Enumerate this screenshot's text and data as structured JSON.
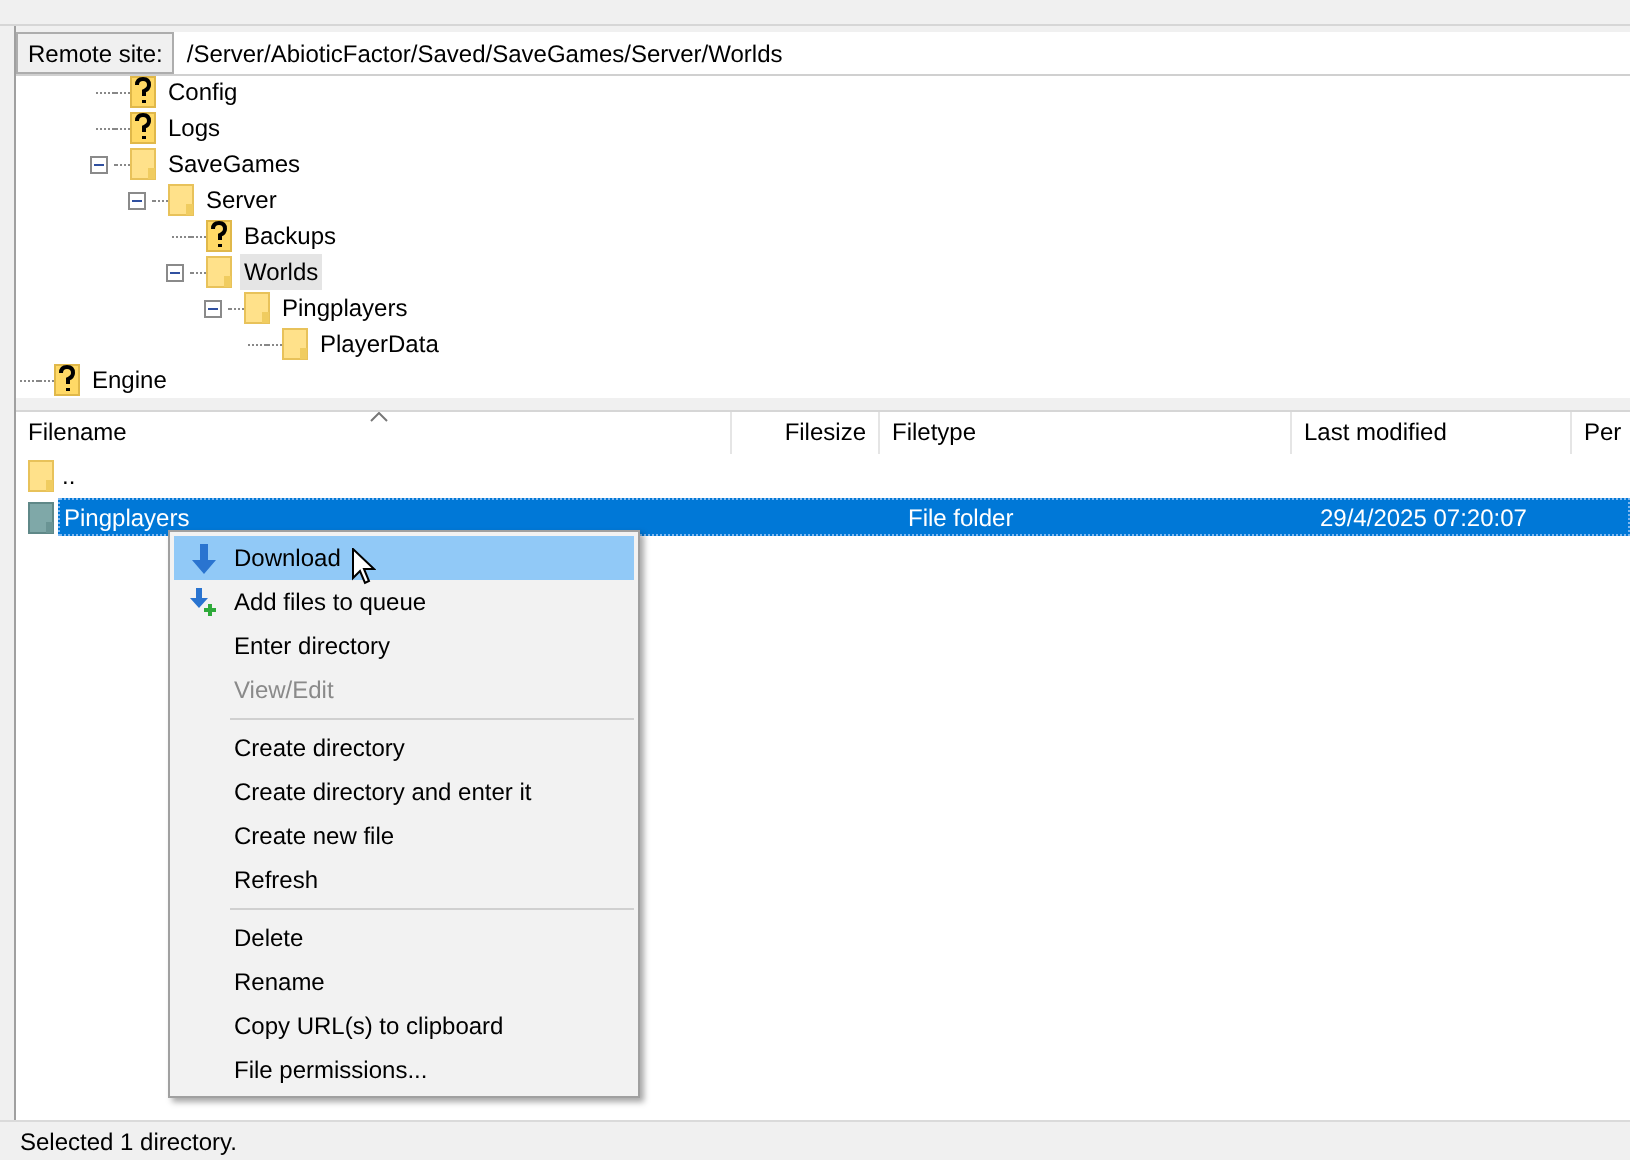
{
  "remote_site": {
    "label": "Remote site:",
    "path": "/Server/AbioticFactor/Saved/SaveGames/Server/Worlds"
  },
  "tree": {
    "items": [
      {
        "children": [
          {
            "children": [
              {
                "label": "Config",
                "kind": "unknown",
                "selected": false
              },
              {
                "label": "Logs",
                "kind": "unknown",
                "selected": false
              },
              {
                "label": "SaveGames",
                "kind": "folder",
                "selected": false,
                "expanded": true,
                "children": [
                  {
                    "label": "Server",
                    "kind": "folder",
                    "selected": false,
                    "expanded": true,
                    "children": [
                      {
                        "label": "Backups",
                        "kind": "unknown",
                        "selected": false
                      },
                      {
                        "label": "Worlds",
                        "kind": "folder",
                        "selected": true,
                        "expanded": true,
                        "children": [
                          {
                            "label": "Pingplayers",
                            "kind": "folder",
                            "selected": false,
                            "expanded": true,
                            "children": [
                              {
                                "label": "PlayerData",
                                "kind": "folder",
                                "selected": false
                              }
                            ]
                          }
                        ]
                      }
                    ]
                  }
                ]
              }
            ]
          }
        ]
      },
      {
        "label": "Engine",
        "kind": "unknown",
        "selected": false
      }
    ]
  },
  "file_list": {
    "columns": [
      "Filename",
      "Filesize",
      "Filetype",
      "Last modified",
      "Per"
    ],
    "rows": [
      {
        "filename": "..",
        "filesize": "",
        "filetype": "",
        "last_modified": "",
        "selected": false
      },
      {
        "filename": "Pingplayers",
        "filesize": "",
        "filetype": "File folder",
        "last_modified": "29/4/2025 07:20:07",
        "selected": true
      }
    ]
  },
  "context_menu": {
    "items": [
      {
        "kind": "download",
        "label": "Download",
        "selected": true,
        "disabled": false
      },
      {
        "kind": "queue",
        "label": "Add files to queue",
        "selected": false,
        "disabled": false
      },
      {
        "kind": "item",
        "label": "Enter directory",
        "selected": false,
        "disabled": false
      },
      {
        "kind": "item",
        "label": "View/Edit",
        "selected": false,
        "disabled": true
      },
      {
        "kind": "separator"
      },
      {
        "kind": "item",
        "label": "Create directory",
        "selected": false,
        "disabled": false
      },
      {
        "kind": "item",
        "label": "Create directory and enter it",
        "selected": false,
        "disabled": false
      },
      {
        "kind": "item",
        "label": "Create new file",
        "selected": false,
        "disabled": false
      },
      {
        "kind": "item",
        "label": "Refresh",
        "selected": false,
        "disabled": false
      },
      {
        "kind": "separator"
      },
      {
        "kind": "item",
        "label": "Delete",
        "selected": false,
        "disabled": false
      },
      {
        "kind": "item",
        "label": "Rename",
        "selected": false,
        "disabled": false
      },
      {
        "kind": "item",
        "label": "Copy URL(s) to clipboard",
        "selected": false,
        "disabled": false
      },
      {
        "kind": "item",
        "label": "File permissions...",
        "selected": false,
        "disabled": false
      }
    ]
  },
  "status_bar": "Selected 1 directory."
}
